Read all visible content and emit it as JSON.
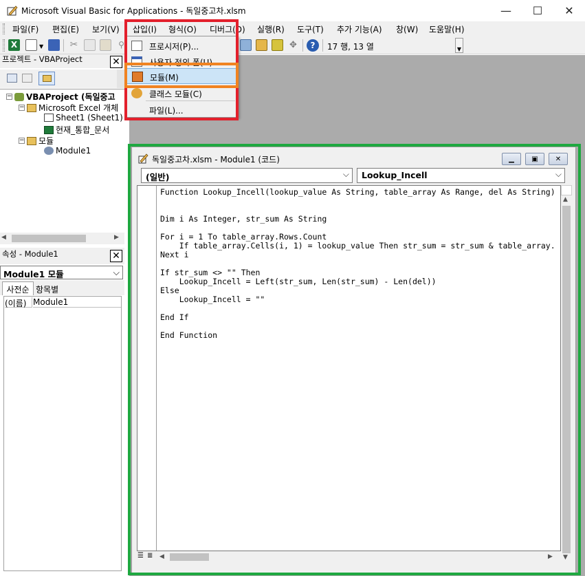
{
  "window": {
    "title": "Microsoft Visual Basic for Applications - 독일중고차.xlsm",
    "minimize_glyph": "—",
    "maximize_glyph": "☐",
    "close_glyph": "✕"
  },
  "menubar": {
    "items": [
      {
        "label": "파일(F)"
      },
      {
        "label": "편집(E)"
      },
      {
        "label": "보기(V)"
      },
      {
        "label": "삽입(I)"
      },
      {
        "label": "형식(O)"
      },
      {
        "label": "디버그(D)"
      },
      {
        "label": "실행(R)"
      },
      {
        "label": "도구(T)"
      },
      {
        "label": "추가 기능(A)"
      },
      {
        "label": "창(W)"
      },
      {
        "label": "도움말(H)"
      }
    ]
  },
  "toolbar": {
    "position_text": "17 행, 13 열"
  },
  "insert_menu": {
    "items": [
      {
        "label": "프로시저(P)...",
        "icon": "procedure-icon"
      },
      {
        "label": "사용자 정의 폼(U)",
        "icon": "userform-icon"
      },
      {
        "label": "모듈(M)",
        "icon": "module-icon",
        "highlighted": true
      },
      {
        "label": "클래스 모듈(C)",
        "icon": "class-module-icon"
      },
      {
        "label": "파일(L)...",
        "icon": ""
      }
    ]
  },
  "project_pane": {
    "title": "프로젝트 - VBAProject",
    "tree": [
      {
        "label": "VBAProject (독일중고",
        "level": 0
      },
      {
        "label": "Microsoft Excel 개체",
        "level": 1
      },
      {
        "label": "Sheet1 (Sheet1)",
        "level": 2
      },
      {
        "label": "현재_통합_문서",
        "level": 2
      },
      {
        "label": "모듈",
        "level": 1
      },
      {
        "label": "Module1",
        "level": 2
      }
    ]
  },
  "properties_pane": {
    "title": "속성 - Module1",
    "object_select": "Module1 모듈",
    "tabs": [
      "사전순",
      "항목별"
    ],
    "rows": [
      {
        "name": "(이름)",
        "value": "Module1"
      }
    ]
  },
  "code_window": {
    "title": "독일중고차.xlsm - Module1 (코드)",
    "object_combo": "(일반)",
    "procedure_combo": "Lookup_Incell",
    "lines": [
      "Function Lookup_Incell(lookup_value As String, table_array As Range, del As String)",
      "",
      "",
      "Dim i As Integer, str_sum As String",
      "",
      "For i = 1 To table_array.Rows.Count",
      "    If table_array.Cells(i, 1) = lookup_value Then str_sum = str_sum & table_array.",
      "Next i",
      "",
      "If str_sum <> \"\" Then",
      "    Lookup_Incell = Left(str_sum, Len(str_sum) - Len(del))",
      "Else",
      "    Lookup_Incell = \"\"",
      "",
      "End If",
      "",
      "End Function"
    ]
  },
  "colors": {
    "red_highlight": "#e3202c",
    "orange_highlight": "#f08321",
    "green_highlight": "#1ea840",
    "menu_selection": "#cce4f7"
  }
}
